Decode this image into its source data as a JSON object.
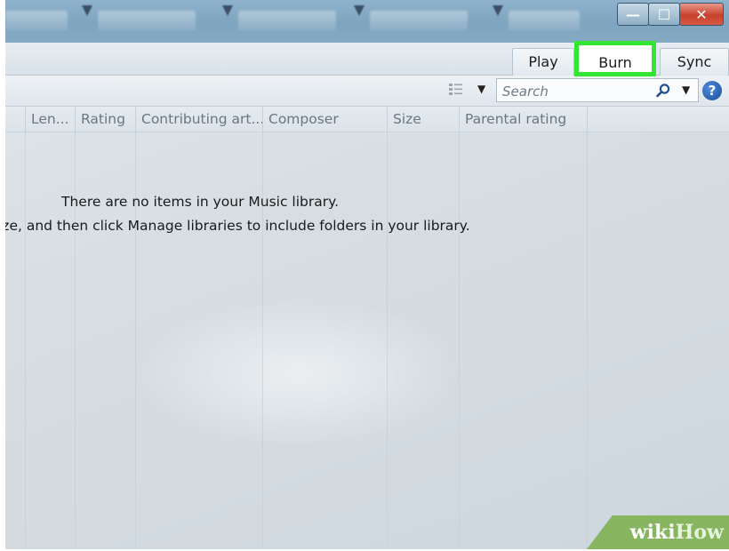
{
  "tabs": {
    "play": "Play",
    "burn": "Burn",
    "sync": "Sync"
  },
  "window_controls": {
    "minimize": "—",
    "maximize": "☐",
    "close": "✕"
  },
  "search": {
    "placeholder": "Search"
  },
  "help_label": "?",
  "columns": [
    "Len...",
    "Rating",
    "Contributing art...",
    "Composer",
    "Size",
    "Parental rating"
  ],
  "empty_state": {
    "line1": "There are no items in your Music library.",
    "line2": "ize, and then click Manage libraries to include folders in your library."
  },
  "watermark": {
    "part1": "wiki",
    "part2": "How"
  },
  "colors": {
    "highlight": "#33e633",
    "titlebar": "#8fb3cc",
    "watermark_bg": "#87b560"
  },
  "icons": [
    "view-options-icon",
    "chevron-down-icon",
    "search-icon",
    "help-icon",
    "minimize-icon",
    "maximize-icon",
    "close-icon"
  ]
}
